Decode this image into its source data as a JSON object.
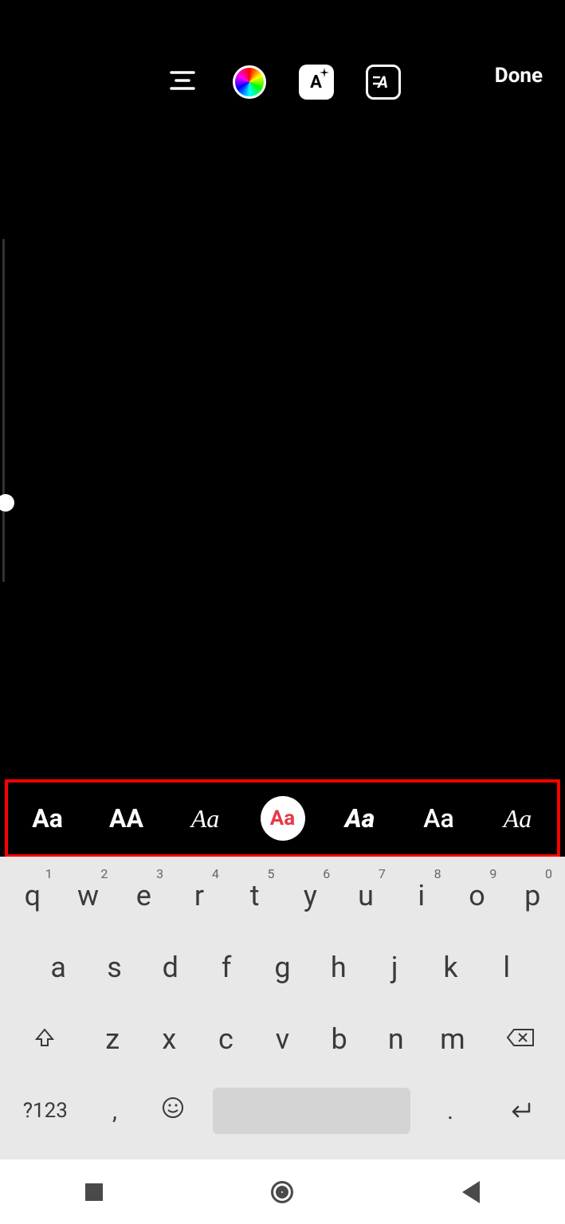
{
  "header": {
    "done_label": "Done",
    "effect_label": "A",
    "animate_label": "A"
  },
  "fonts": [
    {
      "label": "Aa",
      "style": "classic"
    },
    {
      "label": "AA",
      "style": "modern"
    },
    {
      "label": "Aa",
      "style": "script"
    },
    {
      "label": "Aa",
      "style": "typewriter",
      "selected": true
    },
    {
      "label": "Aa",
      "style": "italic-bold"
    },
    {
      "label": "Aa",
      "style": "alt"
    },
    {
      "label": "Aa",
      "style": "serif-italic"
    }
  ],
  "keyboard": {
    "row1": [
      {
        "k": "q",
        "n": "1"
      },
      {
        "k": "w",
        "n": "2"
      },
      {
        "k": "e",
        "n": "3"
      },
      {
        "k": "r",
        "n": "4"
      },
      {
        "k": "t",
        "n": "5"
      },
      {
        "k": "y",
        "n": "6"
      },
      {
        "k": "u",
        "n": "7"
      },
      {
        "k": "i",
        "n": "8"
      },
      {
        "k": "o",
        "n": "9"
      },
      {
        "k": "p",
        "n": "0"
      }
    ],
    "row2": [
      {
        "k": "a"
      },
      {
        "k": "s"
      },
      {
        "k": "d"
      },
      {
        "k": "f"
      },
      {
        "k": "g"
      },
      {
        "k": "h"
      },
      {
        "k": "j"
      },
      {
        "k": "k"
      },
      {
        "k": "l"
      }
    ],
    "row3": [
      {
        "k": "z"
      },
      {
        "k": "x"
      },
      {
        "k": "c"
      },
      {
        "k": "v"
      },
      {
        "k": "b"
      },
      {
        "k": "n"
      },
      {
        "k": "m"
      }
    ],
    "mode_label": "?123",
    "comma": ",",
    "period": "."
  }
}
